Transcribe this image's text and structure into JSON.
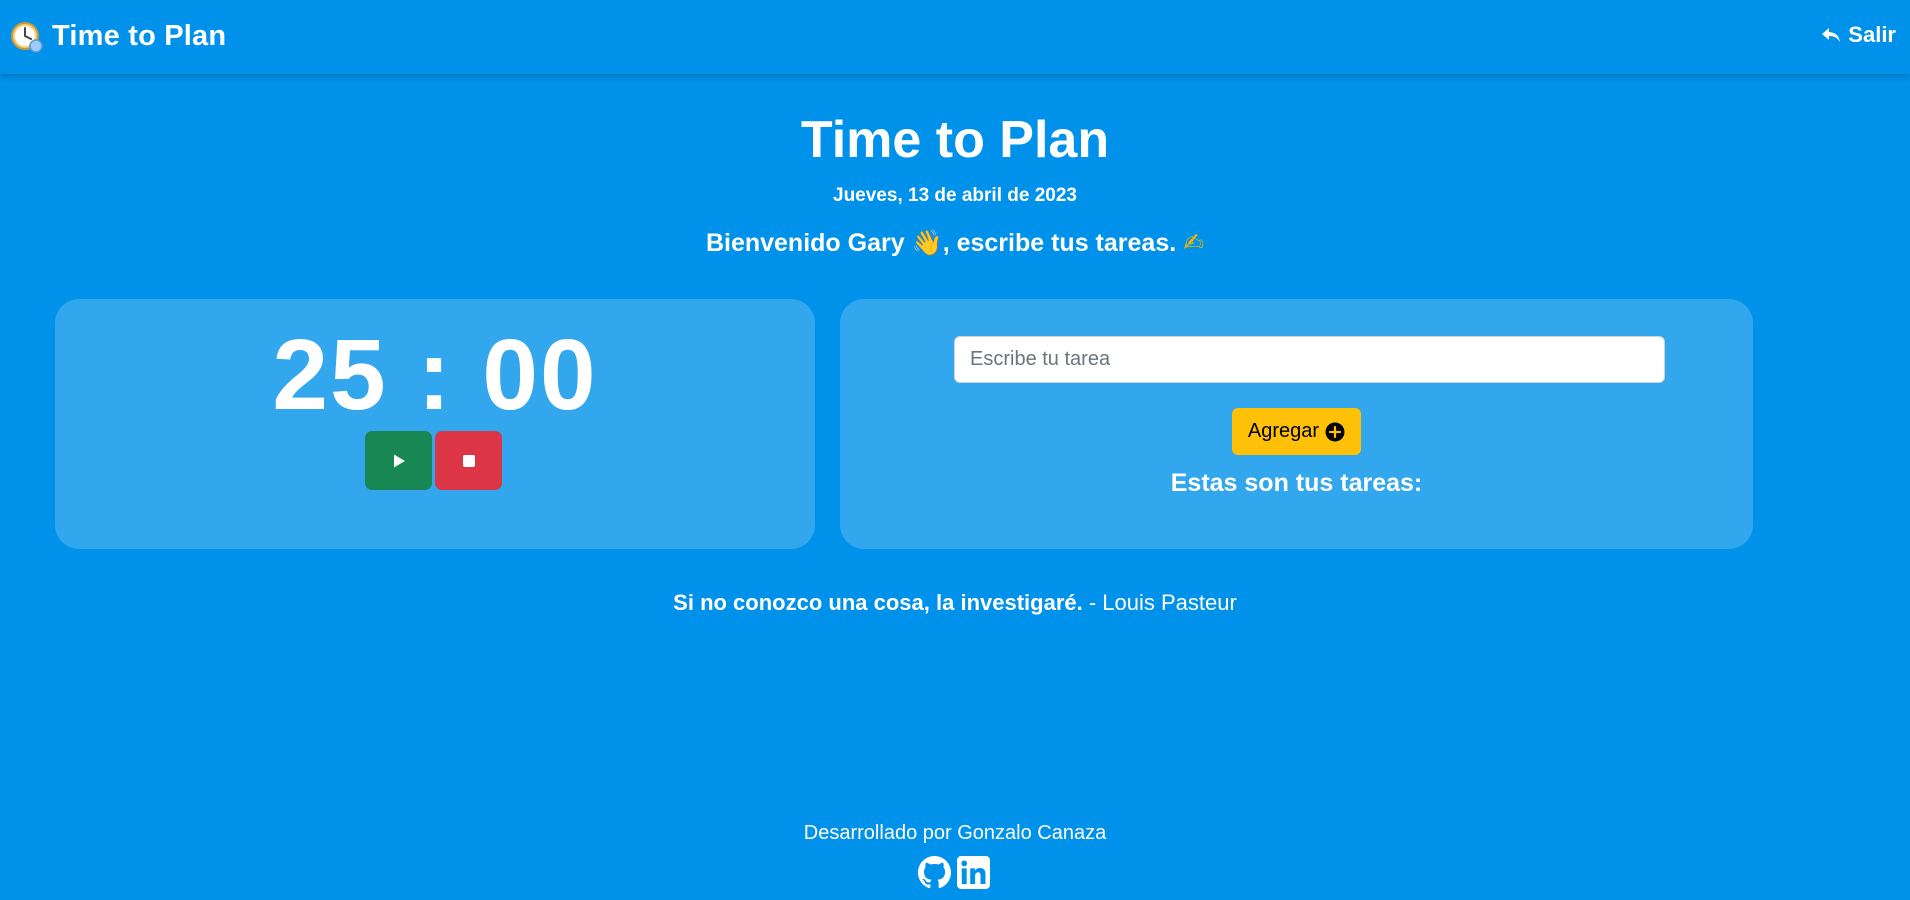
{
  "navbar": {
    "brand_icon": "stopwatch-icon",
    "brand_title": "Time to Plan",
    "logout_icon": "reply-arrow-icon",
    "logout_label": "Salir"
  },
  "header": {
    "title": "Time to Plan",
    "date": "Jueves, 13 de abril de 2023",
    "welcome_before": "Bienvenido Gary ",
    "welcome_emoji_1": "👋",
    "welcome_middle": ", escribe tus tareas. ",
    "welcome_emoji_2": "✍"
  },
  "timer": {
    "display": "25 : 00",
    "play_icon": "play-icon",
    "stop_icon": "stop-icon"
  },
  "tasks": {
    "input_placeholder": "Escribe tu tarea",
    "input_value": "",
    "add_label": "Agregar",
    "add_icon": "plus-circle-icon",
    "heading": "Estas son tus tareas:",
    "items": []
  },
  "quote": {
    "text": "Si no conozco una cosa, la investigaré.",
    "author": " - Louis Pasteur"
  },
  "footer": {
    "credit": "Desarrollado por Gonzalo Canaza",
    "links": [
      "github-icon",
      "linkedin-icon"
    ]
  },
  "colors": {
    "background": "#0091ea",
    "card": "rgba(255,255,255,0.2)",
    "play_button": "#198754",
    "stop_button": "#dc3545",
    "add_button": "#ffc107"
  }
}
